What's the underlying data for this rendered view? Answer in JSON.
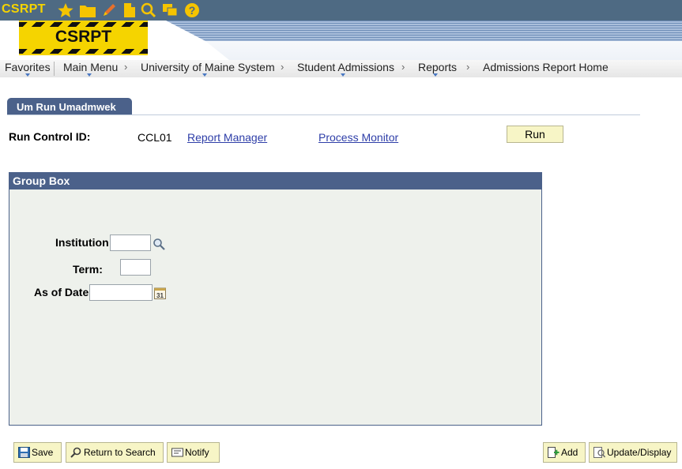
{
  "toolbar": {
    "brand": "CSRPT",
    "icons": [
      "star-icon",
      "folder-icon",
      "pencil-icon",
      "document-icon",
      "search-icon",
      "chat-icon",
      "help-icon"
    ]
  },
  "banner": {
    "logo_text": "CSRPT"
  },
  "nav": {
    "items": [
      "Favorites",
      "Main Menu",
      "University of Maine System",
      "Student Admissions",
      "Reports",
      "Admissions Report Home"
    ],
    "separator": "›"
  },
  "tab": {
    "label": "Um Run Umadmwek"
  },
  "run_control": {
    "label": "Run Control ID:",
    "value": "CCL01",
    "report_manager": "Report Manager",
    "process_monitor": "Process Monitor",
    "run_button": "Run"
  },
  "group_box": {
    "title": "Group Box",
    "fields": {
      "institution": {
        "label": "Institution",
        "value": ""
      },
      "term": {
        "label": "Term:",
        "value": ""
      },
      "as_of_date": {
        "label": "As of Date",
        "value": "",
        "calendar_text": "31"
      }
    }
  },
  "buttons": {
    "save": "Save",
    "return_to_search": "Return to Search",
    "notify": "Notify",
    "add": "Add",
    "update_display": "Update/Display"
  },
  "colors": {
    "toolbar_bg": "#4e6a83",
    "brand_yellow": "#f5d400",
    "tab_blue": "#4b618a",
    "link_blue": "#2e3ea8",
    "button_bg": "#f7f5c6",
    "group_bg": "#eef1ec"
  }
}
